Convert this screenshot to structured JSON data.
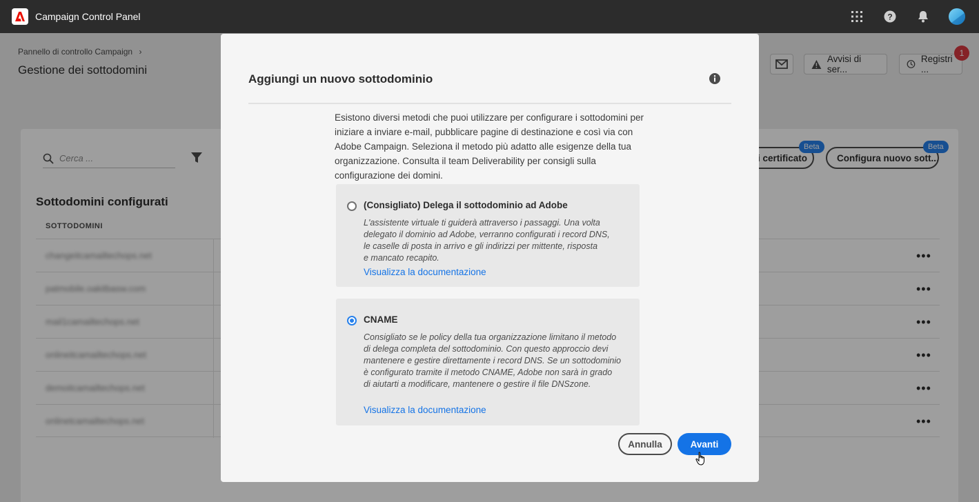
{
  "topbar": {
    "app_title": "Campaign Control Panel",
    "icons": [
      "apps-grid-icon",
      "help-icon",
      "notification-bell-icon",
      "user-avatar"
    ]
  },
  "header": {
    "breadcrumb": "Pannello di controllo Campaign",
    "title": "Gestione dei sottodomini",
    "buttons": {
      "alerts_label": "Avvisi di ser...",
      "logs_label": "Registri ..."
    },
    "logs_badge": "1"
  },
  "toolbar": {
    "search_placeholder": "Cerca ...",
    "certificates_label": "i certificato",
    "configure_label": "Configura nuovo sott...",
    "beta_label": "Beta"
  },
  "table": {
    "section_title": "Sottodomini configurati",
    "column_header": "SOTTODOMINI",
    "rows": [
      "changeitcamailtechops.net",
      "patmobile.oakitbasw.com",
      "mail1camailtechops.net",
      "onlineitcamailtechops.net",
      "demoitcamailtechops.net",
      "onlinetcamailtechops.net"
    ],
    "more_label": "•••"
  },
  "dialog": {
    "title": "Aggiungi un nuovo sottodominio",
    "description_lines": [
      "Esistono diversi metodi che puoi utilizzare per configurare i sottodomini per",
      "iniziare a inviare e-mail, pubblicare pagine di destinazione e così via con",
      "Adobe Campaign. Seleziona il metodo più adatto alle esigenze della tua",
      "organizzazione. Consulta il team Deliverability per consigli sulla",
      "configurazione dei domini."
    ],
    "options": [
      {
        "title": "(Consigliato) Delega il sottodominio ad Adobe",
        "text_lines": [
          "L'assistente virtuale ti guiderà attraverso i passaggi. Una volta",
          "delegato il dominio ad Adobe, verranno configurati i record DNS,",
          "le caselle di posta in arrivo e gli indirizzi per mittente, risposta",
          "e mancato recapito."
        ],
        "link": "Visualizza la documentazione",
        "selected": false
      },
      {
        "title": "CNAME",
        "text_lines": [
          "Consigliato se le policy della tua organizzazione limitano il metodo",
          "di delega completa del sottodominio. Con questo approccio devi",
          "mantenere e gestire direttamente i record DNS. Se un sottodominio",
          "è configurato tramite il metodo CNAME, Adobe non sarà in grado",
          "di aiutarti a modificare, mantenere o gestire il file DNSzone."
        ],
        "link": "Visualizza la documentazione",
        "selected": true
      }
    ],
    "cancel_label": "Annulla",
    "next_label": "Avanti"
  },
  "colors": {
    "accent": "#1473e6",
    "topbar": "#2c2c2c",
    "badge": "#d7373f"
  }
}
